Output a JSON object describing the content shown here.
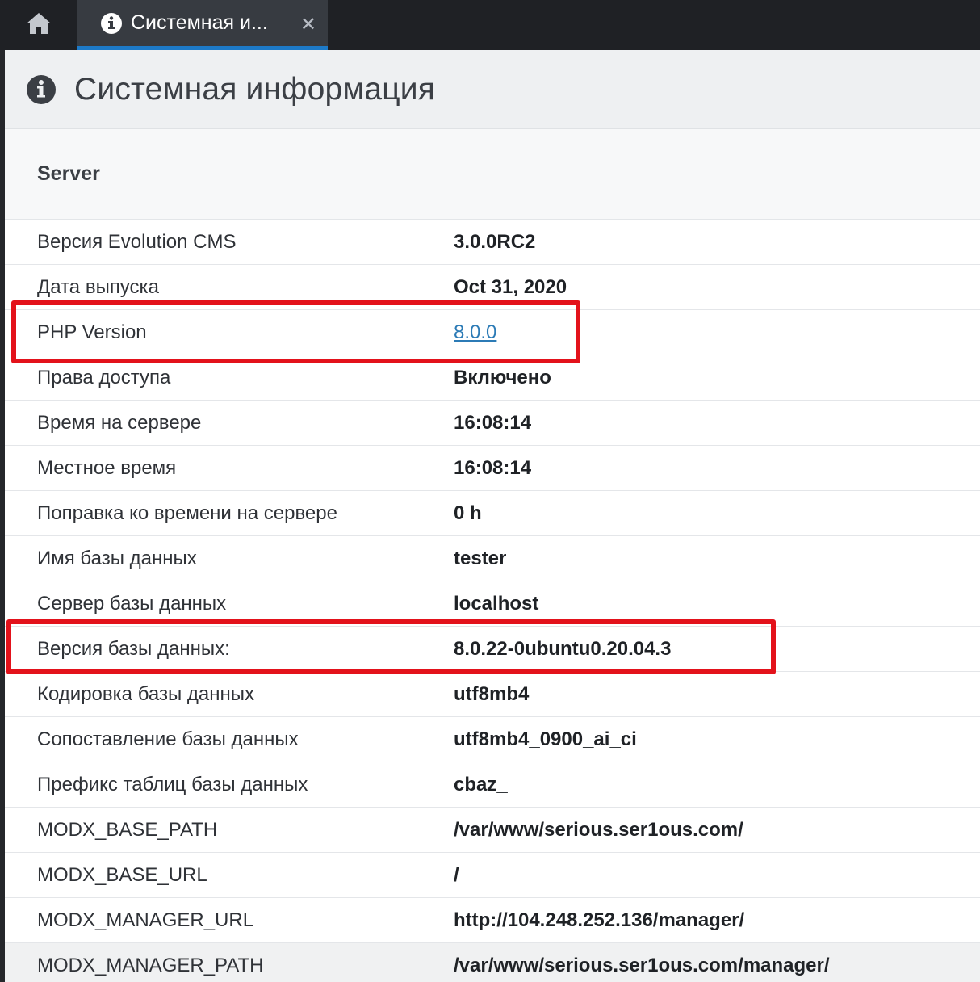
{
  "tabs": {
    "home_icon": "home-icon",
    "active": {
      "icon": "info-icon",
      "title": "Системная и...",
      "close": "✕"
    }
  },
  "header": {
    "icon": "info-circle-icon",
    "title": "Системная информация"
  },
  "section": {
    "title": "Server"
  },
  "rows": [
    {
      "key": "Версия Evolution CMS",
      "value": "3.0.0RC2"
    },
    {
      "key": "Дата выпуска",
      "value": "Oct 31, 2020"
    },
    {
      "key": "PHP Version",
      "value": "8.0.0",
      "link": true
    },
    {
      "key": "Права доступа",
      "value": "Включено"
    },
    {
      "key": "Время на сервере",
      "value": "16:08:14"
    },
    {
      "key": "Местное время",
      "value": "16:08:14"
    },
    {
      "key": "Поправка ко времени на сервере",
      "value": "0 h"
    },
    {
      "key": "Имя базы данных",
      "value": "tester"
    },
    {
      "key": "Сервер базы данных",
      "value": "localhost"
    },
    {
      "key": "Версия базы данных:",
      "value": "8.0.22-0ubuntu0.20.04.3"
    },
    {
      "key": "Кодировка базы данных",
      "value": "utf8mb4"
    },
    {
      "key": "Сопоставление базы данных",
      "value": "utf8mb4_0900_ai_ci"
    },
    {
      "key": "Префикс таблиц базы данных",
      "value": "cbaz_"
    },
    {
      "key": "MODX_BASE_PATH",
      "value": "/var/www/serious.ser1ous.com/"
    },
    {
      "key": "MODX_BASE_URL",
      "value": "/"
    },
    {
      "key": "MODX_MANAGER_URL",
      "value": "http://104.248.252.136/manager/"
    },
    {
      "key": "MODX_MANAGER_PATH",
      "value": "/var/www/serious.ser1ous.com/manager/"
    }
  ],
  "colors": {
    "accent": "#1d7ac8",
    "highlight": "#e3121b",
    "link": "#2c7bb6"
  }
}
